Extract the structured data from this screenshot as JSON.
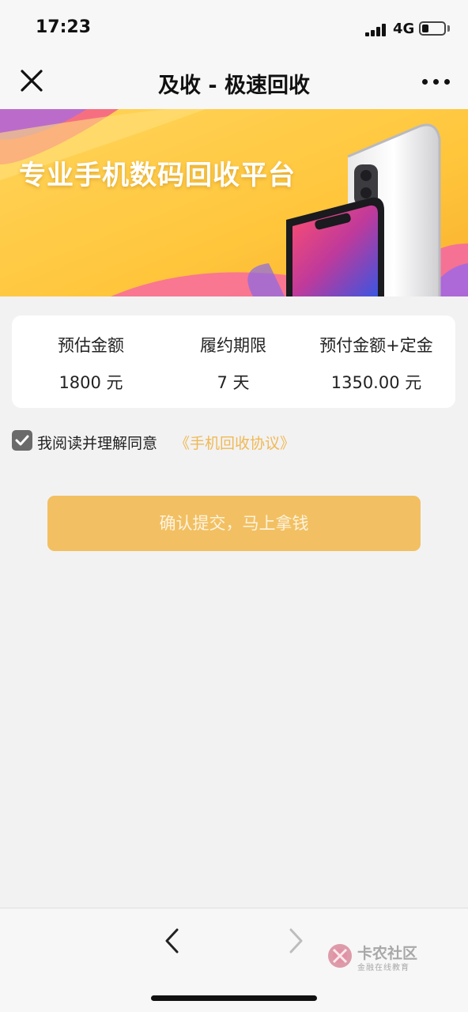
{
  "status_bar": {
    "time": "17:23",
    "network": "4G"
  },
  "nav": {
    "title": "及收 - 极速回收",
    "close_icon": "close-icon",
    "more_icon": "more-dots-icon"
  },
  "banner": {
    "headline": "专业手机数码回收平台"
  },
  "info": {
    "columns": [
      {
        "label": "预估金额",
        "value": "1800 元"
      },
      {
        "label": "履约期限",
        "value": "7 天"
      },
      {
        "label": "预付金额+定金",
        "value": "1350.00 元"
      }
    ]
  },
  "agreement": {
    "checked": true,
    "text": "我阅读并理解同意",
    "link": "《手机回收协议》"
  },
  "submit": {
    "label": "确认提交，马上拿钱"
  },
  "toolbar": {
    "back_icon": "chevron-left-icon",
    "forward_icon": "chevron-right-icon"
  },
  "watermark": {
    "name": "卡农社区",
    "subtitle": "金融在线教育"
  },
  "colors": {
    "accent": "#f2c062",
    "link": "#f0b955",
    "background": "#f2f2f3"
  }
}
